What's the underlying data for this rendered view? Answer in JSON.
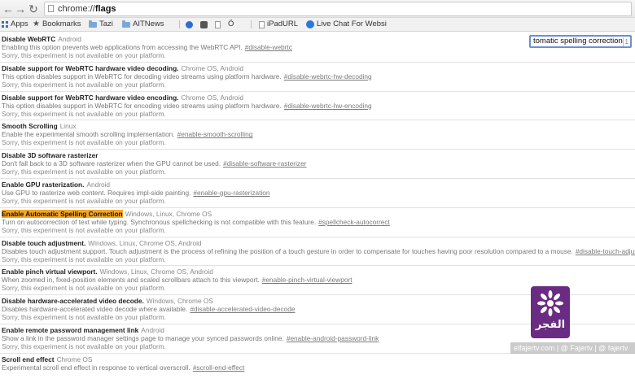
{
  "browser": {
    "back_icon": "back-arrow-icon",
    "forward_icon": "forward-arrow-icon",
    "reload_icon": "reload-icon",
    "url_scheme": "chrome://",
    "url_path": "flags"
  },
  "bookmarks": [
    {
      "label": "Apps",
      "icon": "apps-grid-icon"
    },
    {
      "label": "Bookmarks",
      "icon": "star-icon"
    },
    {
      "label": "Tazi",
      "icon": "folder-icon"
    },
    {
      "label": "AITNews",
      "icon": "folder-icon"
    },
    {
      "label": "",
      "icon": "twitter-bird-icon"
    },
    {
      "label": "",
      "icon": "settings-cube-icon"
    },
    {
      "label": "",
      "icon": "page-icon"
    },
    {
      "label": "Ö",
      "icon": ""
    },
    {
      "label": "iPadURL",
      "icon": "page-icon"
    },
    {
      "label": "Live Chat For Websi",
      "icon": "livechat-icon"
    }
  ],
  "search": {
    "value": "tomatic spelling correction",
    "count": "1"
  },
  "flags": [
    {
      "title": "Disable WebRTC",
      "platforms": "Android",
      "desc": "Enabling this option prevents web applications from accessing the WebRTC API.",
      "link": "#disable-webrtc",
      "na": "Sorry, this experiment is not available on your platform.",
      "highlight": false
    },
    {
      "title": "Disable support for WebRTC hardware video decoding.",
      "platforms": "Chrome OS, Android",
      "desc": "This option disables support in WebRTC for decoding video streams using platform hardware.",
      "link": "#disable-webrtc-hw-decoding",
      "na": "Sorry, this experiment is not available on your platform.",
      "highlight": false
    },
    {
      "title": "Disable support for WebRTC hardware video encoding.",
      "platforms": "Chrome OS, Android",
      "desc": "This option disables support in WebRTC for encoding video streams using platform hardware.",
      "link": "#disable-webrtc-hw-encoding",
      "na": "Sorry, this experiment is not available on your platform.",
      "highlight": false
    },
    {
      "title": "Smooth Scrolling",
      "platforms": "Linux",
      "desc": "Enable the experimental smooth scrolling implementation.",
      "link": "#enable-smooth-scrolling",
      "na": "Sorry, this experiment is not available on your platform.",
      "highlight": false
    },
    {
      "title": "Disable 3D software rasterizer",
      "platforms": "",
      "desc": "Don't fall back to a 3D software rasterizer when the GPU cannot be used.",
      "link": "#disable-software-rasterizer",
      "na": "Sorry, this experiment is not available on your platform.",
      "highlight": false
    },
    {
      "title": "Enable GPU rasterization.",
      "platforms": "Android",
      "desc": "Use GPU to rasterize web content. Requires impl-side painting.",
      "link": "#enable-gpu-rasterization",
      "na": "Sorry, this experiment is not available on your platform.",
      "highlight": false
    },
    {
      "title": "Enable Automatic Spelling Correction",
      "platforms": "Windows, Linux, Chrome OS",
      "desc": "Turn on autocorrection of text while typing. Synchronous spellchecking is not compatible with this feature.",
      "link": "#spellcheck-autocorrect",
      "na": "Sorry, this experiment is not available on your platform.",
      "highlight": true
    },
    {
      "title": "Disable touch adjustment.",
      "platforms": "Windows, Linux, Chrome OS, Android",
      "desc": "Disables touch adjustment support. Touch adjustment is the process of refining the position of a touch gesture in order to compensate for touches having poor resolution compared to a mouse.",
      "link": "#disable-touch-adjustment",
      "na": "Sorry, this experiment is not available on your platform.",
      "highlight": false
    },
    {
      "title": "Enable pinch virtual viewport.",
      "platforms": "Windows, Linux, Chrome OS, Android",
      "desc": "When zoomed in, fixed-position elements and scaled scrollbars attach to this viewport.",
      "link": "#enable-pinch-virtual-viewport",
      "na": "Sorry, this experiment is not available on your platform.",
      "highlight": false
    },
    {
      "title": "Disable hardware-accelerated video decode.",
      "platforms": "Windows, Chrome OS",
      "desc": "Disables hardware-accelerated video decode where available.",
      "link": "#disable-accelerated-video-decode",
      "na": "Sorry, this experiment is not available on your platform.",
      "highlight": false
    },
    {
      "title": "Enable remote password management link",
      "platforms": "Android",
      "desc": "Show a link in the password manager settings page to manage your synced passwords online.",
      "link": "#enable-android-password-link",
      "na": "Sorry, this experiment is not available on your platform.",
      "highlight": false
    },
    {
      "title": "Scroll end effect",
      "platforms": "Chrome OS",
      "desc": "Experimental scroll end effect in response to vertical overscroll.",
      "link": "#scroll-end-effect",
      "na": "",
      "highlight": false
    }
  ],
  "watermark": {
    "logo_text": "الفجر",
    "site": "elfajertv.com | @ Fajertv | @ fajertv",
    "logo_color": "#6a2c83"
  }
}
